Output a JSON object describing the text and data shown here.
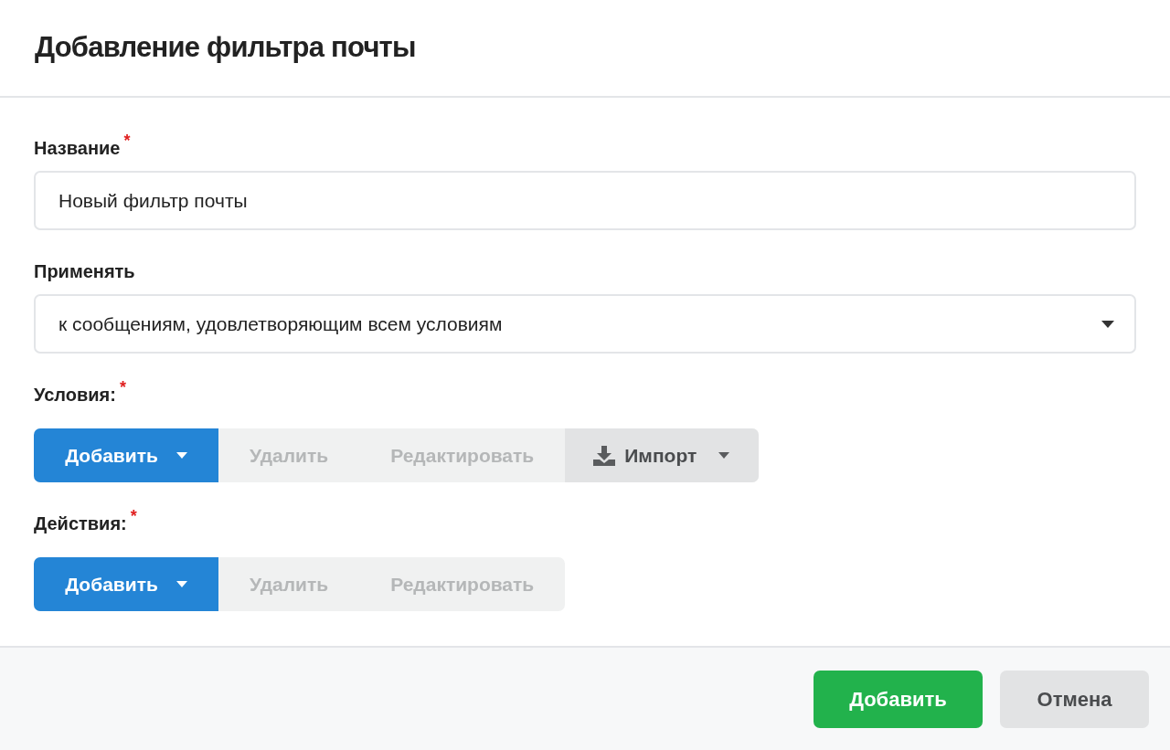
{
  "dialog": {
    "title": "Добавление фильтра почты"
  },
  "fields": [
    {
      "kind": "text",
      "label": "Название",
      "required_mark": "*",
      "value": "Новый фильтр почты"
    },
    {
      "kind": "select",
      "label": "Применять",
      "value": "к сообщениям, удовлетворяющим всем условиям"
    }
  ],
  "sections": [
    {
      "label": "Условия:",
      "required_mark": "*",
      "buttons": [
        {
          "kind": "add",
          "label": "Добавить",
          "disabled": false
        },
        {
          "kind": "action",
          "label": "Удалить",
          "disabled": true
        },
        {
          "kind": "action",
          "label": "Редактировать",
          "disabled": true
        },
        {
          "kind": "import",
          "label": "Импорт",
          "disabled": false
        }
      ]
    },
    {
      "label": "Действия:",
      "required_mark": "*",
      "buttons": [
        {
          "kind": "add",
          "label": "Добавить",
          "disabled": false
        },
        {
          "kind": "action",
          "label": "Удалить",
          "disabled": true
        },
        {
          "kind": "action",
          "label": "Редактировать",
          "disabled": true
        }
      ]
    }
  ],
  "footer_buttons": [
    {
      "kind": "primary",
      "label": "Добавить"
    },
    {
      "kind": "secondary",
      "label": "Отмена"
    }
  ]
}
